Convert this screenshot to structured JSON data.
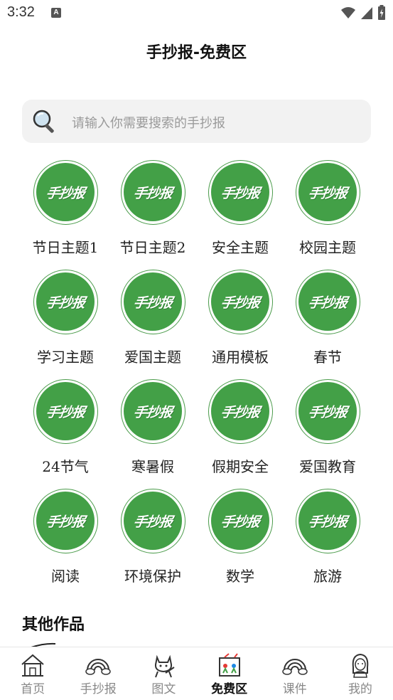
{
  "status_bar": {
    "time": "3:32",
    "a_icon": "A"
  },
  "header": {
    "title": "手抄报-免费区"
  },
  "search": {
    "placeholder": "请输入你需要搜索的手抄报"
  },
  "badge_text": "手抄报",
  "badge_colors": {
    "fill": "#43a047",
    "ring": "#4a9b4a"
  },
  "categories": [
    {
      "label": "节日主题1"
    },
    {
      "label": "节日主题2"
    },
    {
      "label": "安全主题"
    },
    {
      "label": "校园主题"
    },
    {
      "label": "学习主题"
    },
    {
      "label": "爱国主题"
    },
    {
      "label": "通用模板"
    },
    {
      "label": "春节"
    },
    {
      "label": "24节气"
    },
    {
      "label": "寒暑假"
    },
    {
      "label": "假期安全"
    },
    {
      "label": "爱国教育"
    },
    {
      "label": "阅读"
    },
    {
      "label": "环境保护"
    },
    {
      "label": "数学"
    },
    {
      "label": "旅游"
    }
  ],
  "section": {
    "other_works": "其他作品"
  },
  "tabs": [
    {
      "label": "首页",
      "icon": "house-icon",
      "active": false
    },
    {
      "label": "手抄报",
      "icon": "rainbow-icon",
      "active": false
    },
    {
      "label": "图文",
      "icon": "cat-icon",
      "active": false
    },
    {
      "label": "免费区",
      "icon": "kids-drawing-icon",
      "active": true
    },
    {
      "label": "课件",
      "icon": "rainbow-icon",
      "active": false
    },
    {
      "label": "我的",
      "icon": "girl-icon",
      "active": false
    }
  ]
}
